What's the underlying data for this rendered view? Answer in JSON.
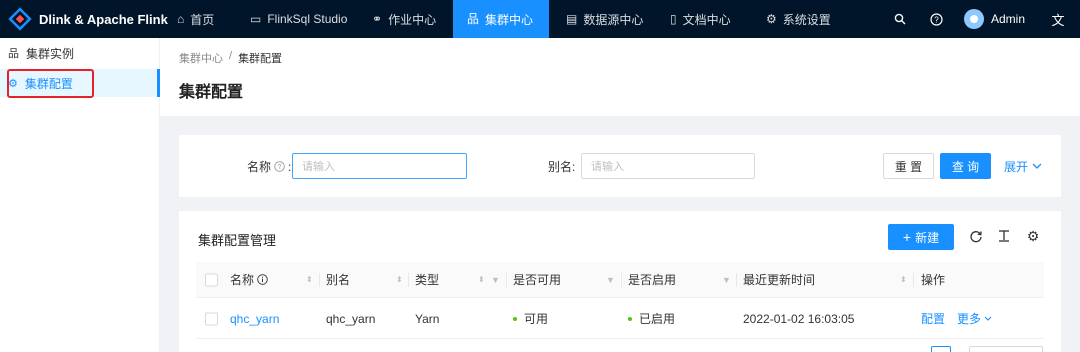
{
  "brand": {
    "title": "Dlink & Apache Flink"
  },
  "nav": [
    {
      "label": "首页",
      "icon": "home-icon"
    },
    {
      "label": "FlinkSql Studio",
      "icon": "console-icon"
    },
    {
      "label": "作业中心",
      "icon": "job-icon"
    },
    {
      "label": "集群中心",
      "icon": "cluster-icon",
      "active": true
    },
    {
      "label": "数据源中心",
      "icon": "database-icon"
    },
    {
      "label": "文档中心",
      "icon": "document-icon"
    },
    {
      "label": "系统设置",
      "icon": "settings-icon"
    }
  ],
  "user": {
    "name": "Admin"
  },
  "sidebar": {
    "items": [
      {
        "label": "集群实例",
        "icon": "cluster-icon"
      },
      {
        "label": "集群配置",
        "icon": "gear-icon",
        "active": true
      }
    ]
  },
  "breadcrumb": {
    "parent": "集群中心",
    "separator": "/",
    "current": "集群配置"
  },
  "page": {
    "title": "集群配置"
  },
  "search": {
    "name_label": "名称",
    "name_placeholder": "请输入",
    "alias_label": "别名:",
    "alias_placeholder": "请输入",
    "reset_label": "重 置",
    "query_label": "查 询",
    "expand_label": "展开"
  },
  "table": {
    "title": "集群配置管理",
    "new_label": "新建",
    "columns": [
      "名称",
      "别名",
      "类型",
      "是否可用",
      "是否启用",
      "最近更新时间",
      "操作"
    ],
    "rows": [
      {
        "name": "qhc_yarn",
        "alias": "qhc_yarn",
        "type": "Yarn",
        "available": "可用",
        "enabled": "已启用",
        "updated": "2022-01-02 16:03:05",
        "action_config": "配置",
        "action_more": "更多"
      }
    ]
  },
  "colors": {
    "primary": "#1890ff",
    "header_bg": "#001529",
    "success": "#52c41a",
    "highlight_box": "#e8202a"
  }
}
